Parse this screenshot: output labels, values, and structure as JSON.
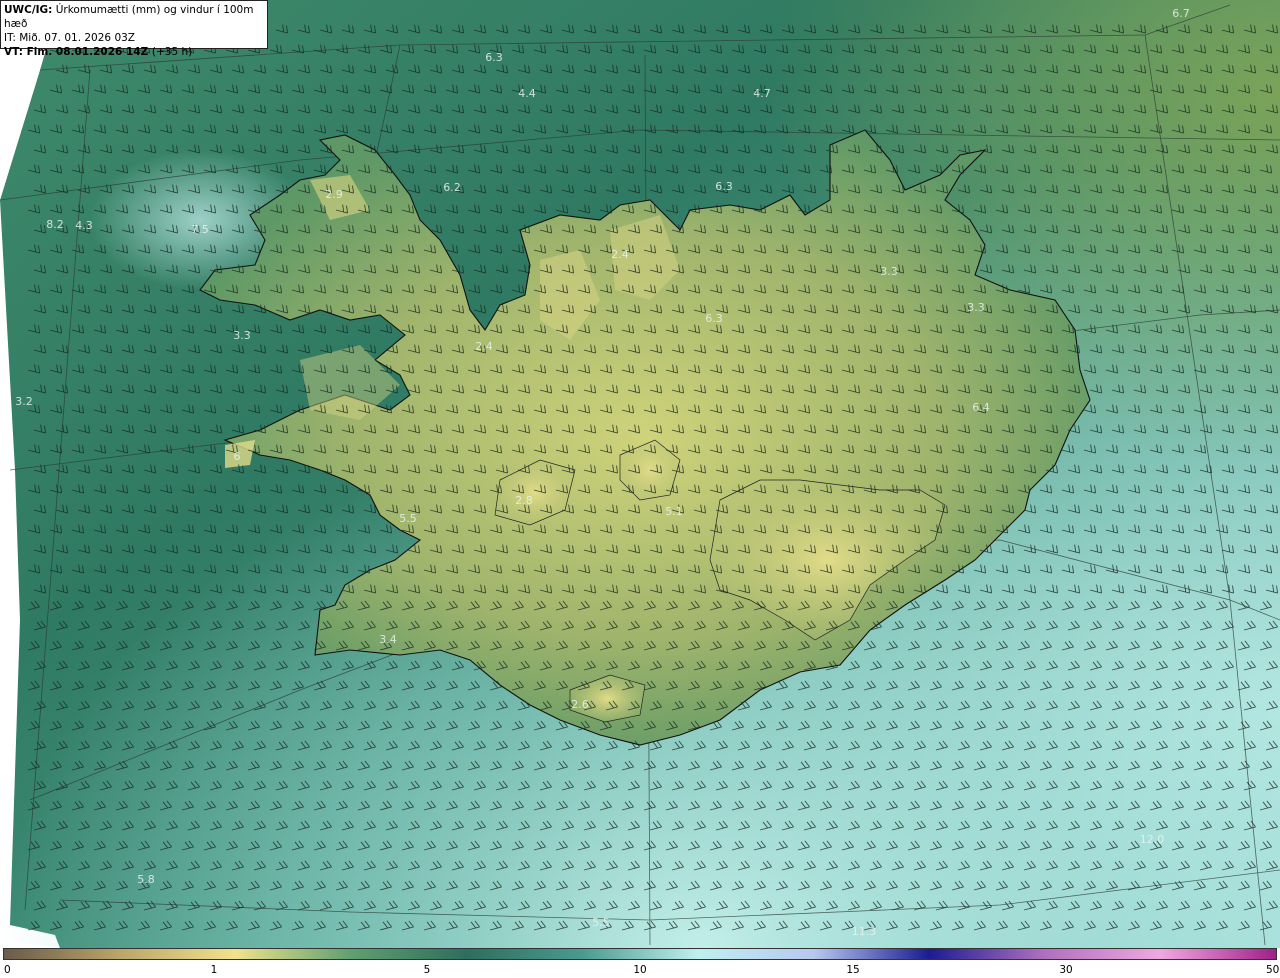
{
  "header": {
    "model": "UWC/IG:",
    "title": "Úrkomumætti (mm) og vindur í 100m hæð",
    "initial_time": "IT: Mið. 07. 01. 2026 03Z",
    "valid_time": "VT: Fim. 08.01.2026 14Z",
    "lead": "(+35 h)"
  },
  "colorbar": {
    "ticks": [
      "0",
      "1",
      "5",
      "10",
      "15",
      "30",
      "50"
    ],
    "colors": [
      "#6b5a4a",
      "#b9a66a",
      "#f0e38c",
      "#5fa070",
      "#2d6e5e",
      "#4a9a90",
      "#bff0ef",
      "#b8c8f0",
      "#1c1c90",
      "#b070c0",
      "#f0a8e0",
      "#a0208a"
    ]
  },
  "map": {
    "labels": [
      {
        "text": "6.7"
      },
      {
        "text": "6.3"
      },
      {
        "text": "4.4"
      },
      {
        "text": "4.7"
      },
      {
        "text": "2.9"
      },
      {
        "text": "6.2"
      },
      {
        "text": "6.3"
      },
      {
        "text": "8.2"
      },
      {
        "text": "4.3"
      },
      {
        "text": "7.5"
      },
      {
        "text": "2.4"
      },
      {
        "text": "3.3"
      },
      {
        "text": "3.3"
      },
      {
        "text": "3.3"
      },
      {
        "text": "6.3"
      },
      {
        "text": "2.4"
      },
      {
        "text": "3.2"
      },
      {
        "text": "6.4"
      },
      {
        "text": "6"
      },
      {
        "text": "2.8"
      },
      {
        "text": "5.1"
      },
      {
        "text": "5.5"
      },
      {
        "text": "3.4"
      },
      {
        "text": "2.6"
      },
      {
        "text": "5.8"
      },
      {
        "text": "5.5"
      },
      {
        "text": "12.0"
      },
      {
        "text": "11.3"
      }
    ]
  }
}
